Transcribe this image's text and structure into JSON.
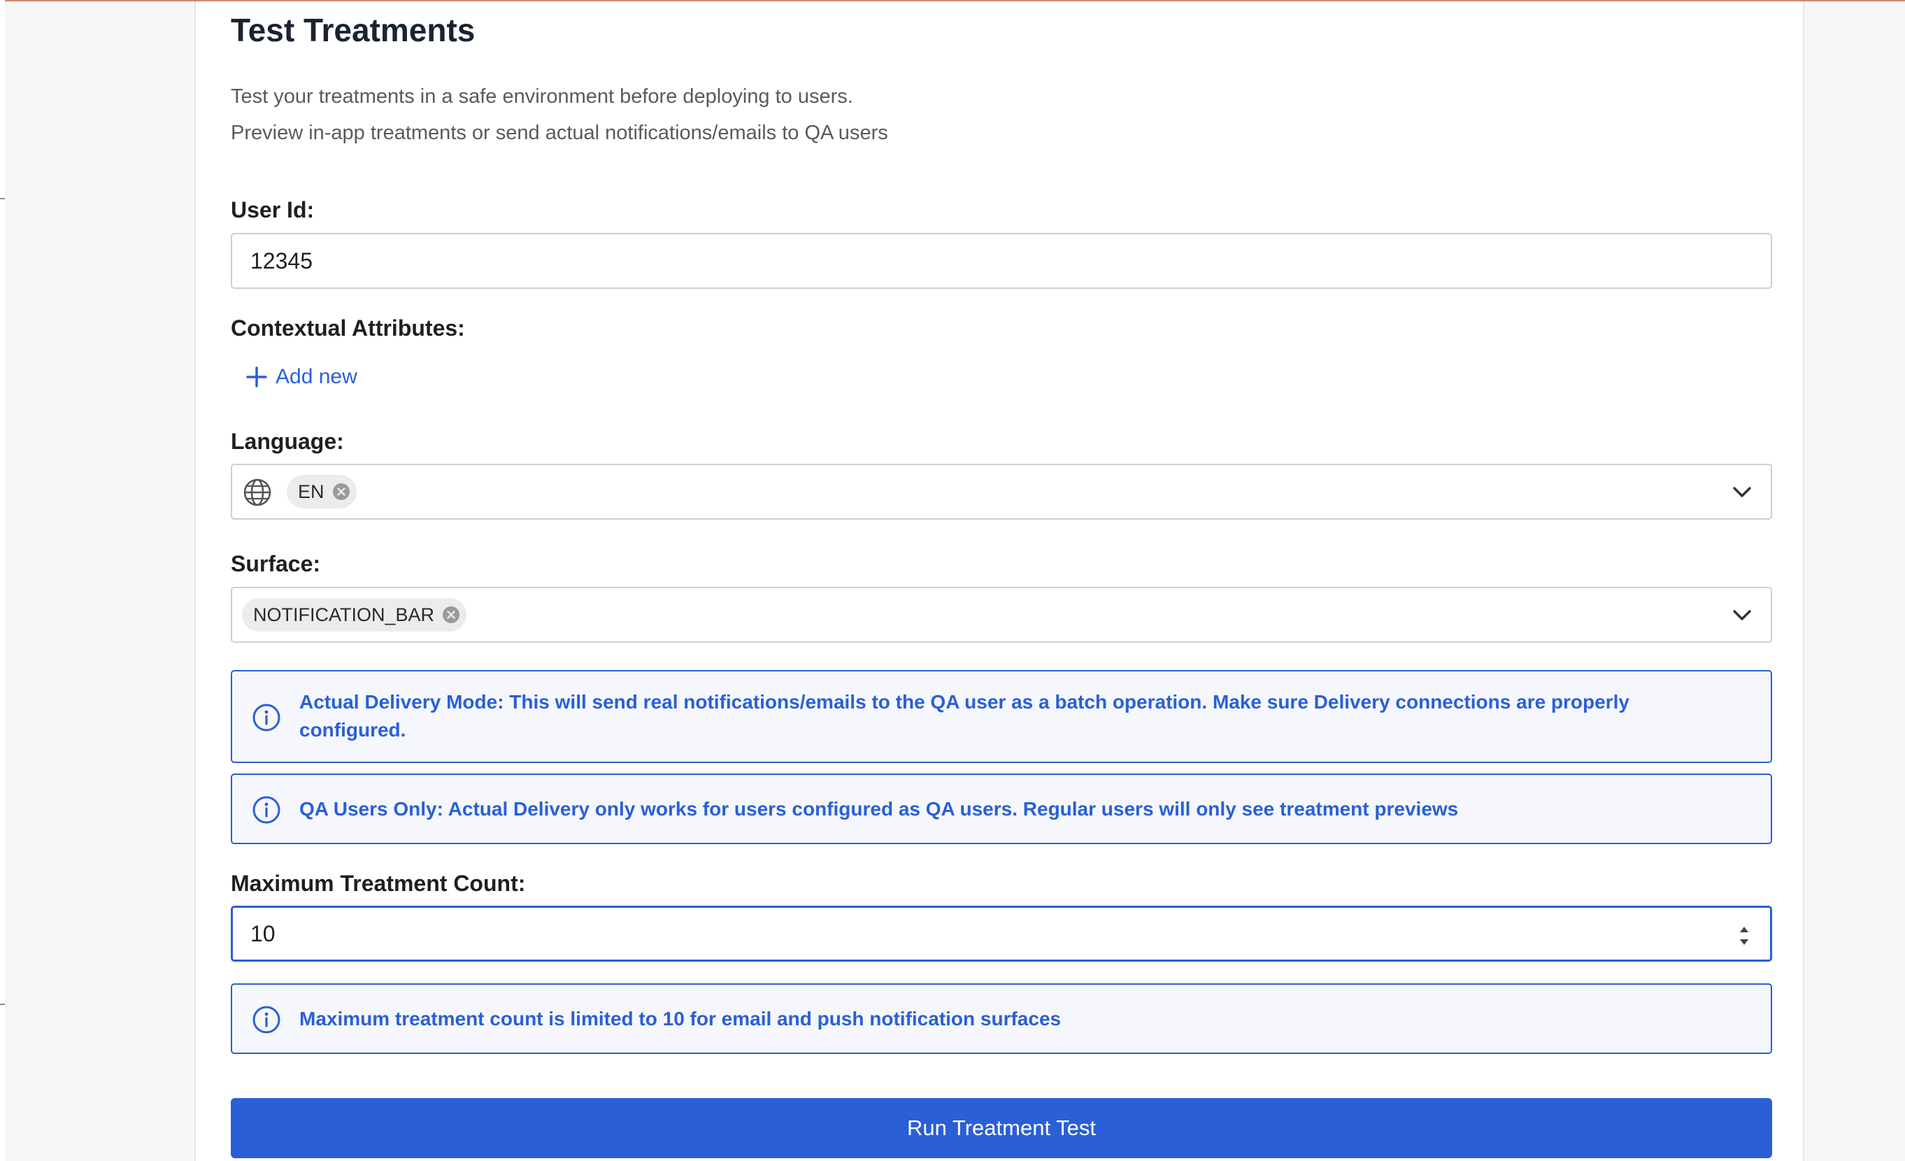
{
  "page": {
    "title": "Test Treatments",
    "subtitle_line1": "Test your treatments in a safe environment before deploying to users.",
    "subtitle_line2": "Preview in-app treatments or send actual notifications/emails to QA users"
  },
  "user_id": {
    "label": "User Id:",
    "value": "12345"
  },
  "contextual_attributes": {
    "label": "Contextual Attributes:",
    "add_new_label": "Add new",
    "add_icon": "plus-icon"
  },
  "language": {
    "label": "Language:",
    "icon": "globe-icon",
    "selected": [
      "EN"
    ]
  },
  "surface": {
    "label": "Surface:",
    "selected": [
      "NOTIFICATION_BAR"
    ]
  },
  "info": {
    "delivery_mode": "Actual Delivery Mode: This will send real notifications/emails to the QA user as a batch operation. Make sure Delivery connections are properly configured.",
    "qa_only": "QA Users Only: Actual Delivery only works for users configured as QA users. Regular users will only see treatment previews",
    "max_count_note": "Maximum treatment count is limited to 10 for email and push notification surfaces"
  },
  "max_treatment_count": {
    "label": "Maximum Treatment Count:",
    "value": "10"
  },
  "actions": {
    "run_label": "Run Treatment Test"
  },
  "colors": {
    "accent": "#2a5fd6",
    "info_bg": "#f5f7fc",
    "chip_bg": "#ececec",
    "top_line": "#d9826c"
  }
}
